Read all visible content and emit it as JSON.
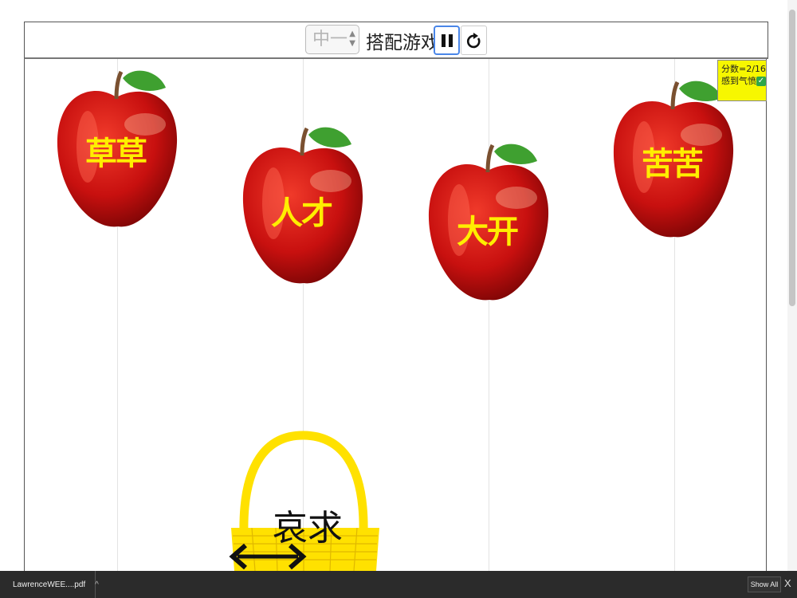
{
  "toolbar": {
    "level_value": "中一",
    "title": "搭配游戏"
  },
  "score": {
    "line1": "分数=2/16",
    "line2": "感到气愤",
    "check": "✓"
  },
  "apples": [
    {
      "label": "草草"
    },
    {
      "label": "人才"
    },
    {
      "label": "大开"
    },
    {
      "label": "苦苦"
    }
  ],
  "basket": {
    "label": "哀求"
  },
  "download_bar": {
    "filename": "LawrenceWEE....pdf",
    "chevron": "^",
    "show_all": "Show All",
    "close": "X"
  },
  "colors": {
    "apple_red": "#c8100f",
    "label_yellow": "#ffee00",
    "score_bg": "#f7f700",
    "basket_yellow": "#ffe100"
  }
}
